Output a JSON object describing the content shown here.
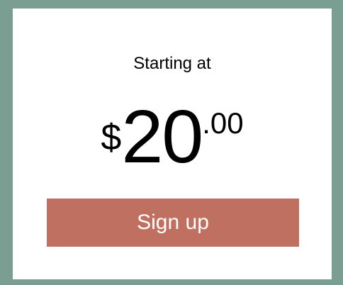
{
  "pricing_card": {
    "starting_label": "Starting at",
    "price": {
      "currency": "$",
      "whole": "20",
      "cents": ".00"
    },
    "signup_label": "Sign up"
  },
  "colors": {
    "page_background": "#7b9e92",
    "card_background": "#ffffff",
    "button_background": "#c07060",
    "button_text": "#ffffff"
  }
}
